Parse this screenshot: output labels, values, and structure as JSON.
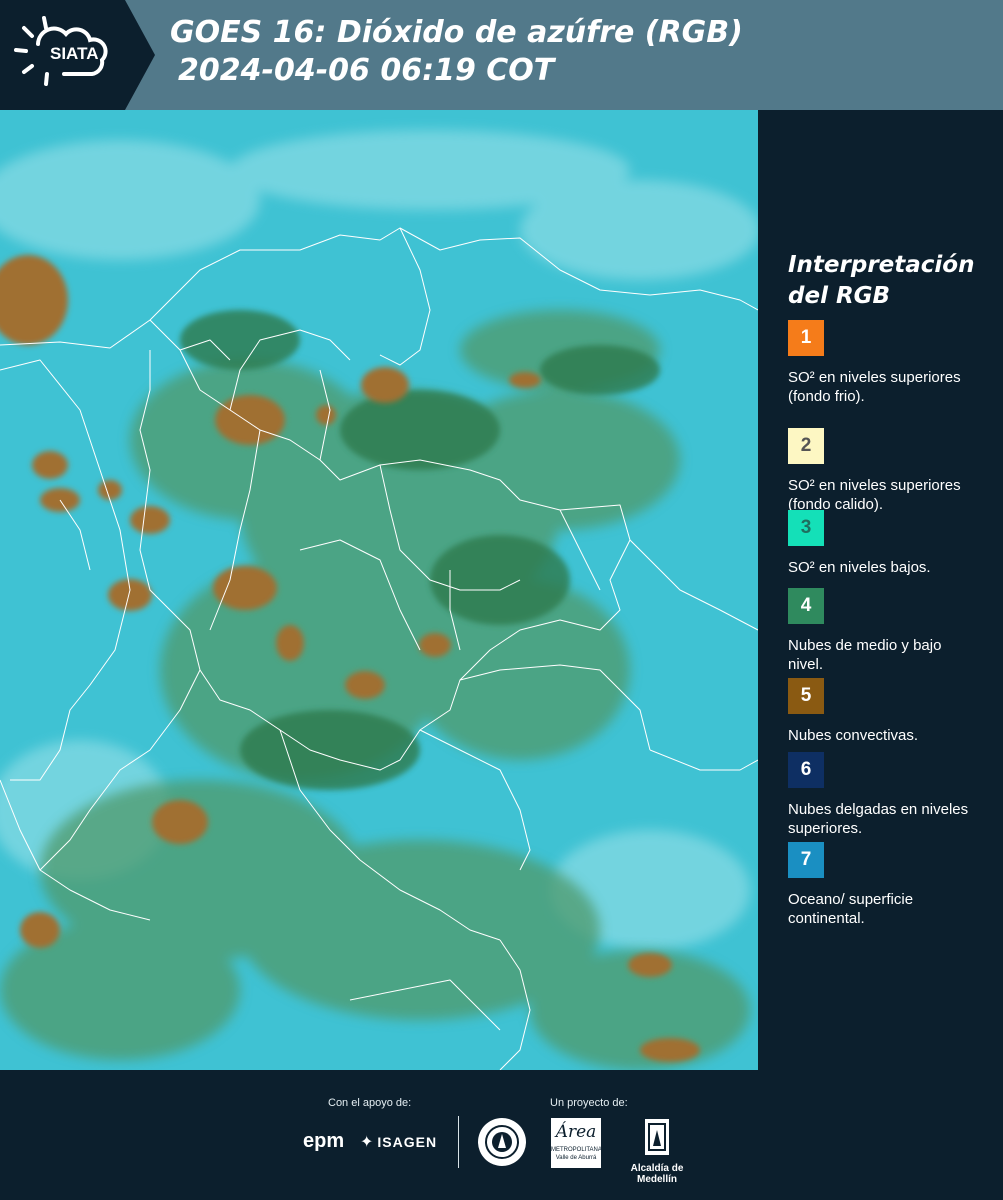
{
  "header": {
    "logo_text": "SIATA",
    "title_line1": "GOES 16: Dióxido de azúfre (RGB)",
    "title_line2": "2024-04-06 06:19 COT"
  },
  "legend": {
    "title": "Interpretación del RGB",
    "items": [
      {
        "number": "1",
        "label": "SO² en niveles superiores (fondo frio).",
        "color": "#f57c1a",
        "text_color": "#ffffff"
      },
      {
        "number": "2",
        "label": "SO² en niveles superiores (fondo calido).",
        "color": "#fdf7c3",
        "text_color": "#555555"
      },
      {
        "number": "3",
        "label": "SO² en niveles bajos.",
        "color": "#14e0b8",
        "text_color": "#1f6f5f"
      },
      {
        "number": "4",
        "label": "Nubes de medio y bajo nivel.",
        "color": "#2f8a5e",
        "text_color": "#ffffff"
      },
      {
        "number": "5",
        "label": "Nubes convectivas.",
        "color": "#8a5a12",
        "text_color": "#ffffff"
      },
      {
        "number": "6",
        "label": "Nubes delgadas en niveles superiores.",
        "color": "#0e2f63",
        "text_color": "#ffffff"
      },
      {
        "number": "7",
        "label": "Oceano/ superficie continental.",
        "color": "#1a8fc2",
        "text_color": "#ffffff"
      }
    ]
  },
  "footer": {
    "support_label": "Con el apoyo de:",
    "project_label": "Un proyecto de:",
    "epm": "epm",
    "isagen": "ISAGEN",
    "area_metro": "METROPOLITANA",
    "area_sub": "Valle de Aburrá",
    "area_name": "Área",
    "medellin": "Alcaldía de Medellín"
  },
  "map_colors": {
    "ocean": "#3fc2d3",
    "low_cloud": "#4f9a6c",
    "mid_cloud": "#3d8f5c",
    "convective": "#a07030",
    "boundary": "#ffffff"
  }
}
